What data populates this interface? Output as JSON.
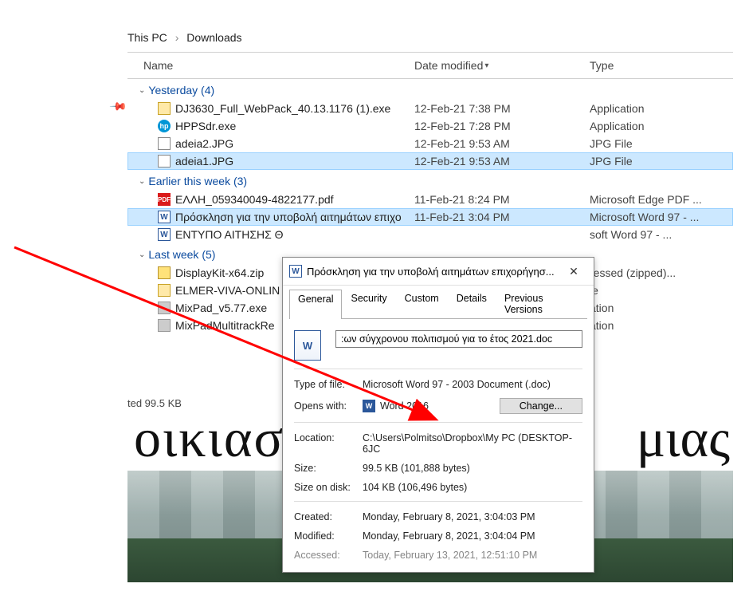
{
  "breadcrumb": {
    "part1": "This PC",
    "part2": "Downloads"
  },
  "columns": {
    "name": "Name",
    "date": "Date modified",
    "type": "Type"
  },
  "groups": [
    {
      "label": "Yesterday (4)",
      "rows": [
        {
          "icon": "exe",
          "name": "DJ3630_Full_WebPack_40.13.1176 (1).exe",
          "date": "12-Feb-21 7:38 PM",
          "type": "Application",
          "selected": false
        },
        {
          "icon": "hp",
          "name": "HPPSdr.exe",
          "date": "12-Feb-21 7:28 PM",
          "type": "Application",
          "selected": false
        },
        {
          "icon": "jpg",
          "name": "adeia2.JPG",
          "date": "12-Feb-21 9:53 AM",
          "type": "JPG File",
          "selected": false
        },
        {
          "icon": "jpg",
          "name": "adeia1.JPG",
          "date": "12-Feb-21 9:53 AM",
          "type": "JPG File",
          "selected": true
        }
      ]
    },
    {
      "label": "Earlier this week (3)",
      "rows": [
        {
          "icon": "pdf",
          "name": "ΕΛΛΗ_059340049-4822177.pdf",
          "date": "11-Feb-21 8:24 PM",
          "type": "Microsoft Edge PDF ...",
          "selected": false
        },
        {
          "icon": "doc",
          "name": "Πρόσκληση για την υποβολή αιτημάτων επιχο",
          "date": "11-Feb-21 3:04 PM",
          "type": "Microsoft Word 97 - ...",
          "selected": true
        },
        {
          "icon": "doc",
          "name": "ΕΝΤΥΠΟ ΑΙΤΗΣΗΣ Θ",
          "date": "",
          "type": "soft Word 97 - ...",
          "selected": false
        }
      ]
    },
    {
      "label": "Last week (5)",
      "rows": [
        {
          "icon": "zip",
          "name": "DisplayKit-x64.zip",
          "date": "",
          "type": "ressed (zipped)...",
          "selected": false
        },
        {
          "icon": "exe",
          "name": "ELMER-VIVA-ONLIN",
          "date": "",
          "type": "le",
          "selected": false
        },
        {
          "icon": "app",
          "name": "MixPad_v5.77.exe",
          "date": "",
          "type": "ation",
          "selected": false
        },
        {
          "icon": "app",
          "name": "MixPadMultitrackRe",
          "date": "",
          "type": "ation",
          "selected": false
        }
      ]
    }
  ],
  "status_caption": "ted  99.5 KB",
  "bg_words": {
    "left": "οικιαστ",
    "right": "μιας"
  },
  "properties": {
    "title": "Πρόσκληση για την υποβολή αιτημάτων επιχορήγησ...",
    "tabs": [
      "General",
      "Security",
      "Custom",
      "Details",
      "Previous Versions"
    ],
    "filename_visible": ":ων σύγχρονου πολιτισμού για το έτος 2021.doc",
    "type_of_file_label": "Type of file:",
    "type_of_file": "Microsoft Word 97 - 2003 Document (.doc)",
    "opens_with_label": "Opens with:",
    "opens_with": "Word 2016",
    "change_btn": "Change...",
    "location_label": "Location:",
    "location": "C:\\Users\\Polmitso\\Dropbox\\My PC (DESKTOP-6JC",
    "size_label": "Size:",
    "size": "99.5 KB (101,888 bytes)",
    "size_on_disk_label": "Size on disk:",
    "size_on_disk": "104 KB (106,496 bytes)",
    "created_label": "Created:",
    "created": "Monday, February 8, 2021, 3:04:03 PM",
    "modified_label": "Modified:",
    "modified": "Monday, February 8, 2021, 3:04:04 PM",
    "accessed_label": "Accessed:",
    "accessed": "Today, February 13, 2021, 12:51:10 PM"
  }
}
